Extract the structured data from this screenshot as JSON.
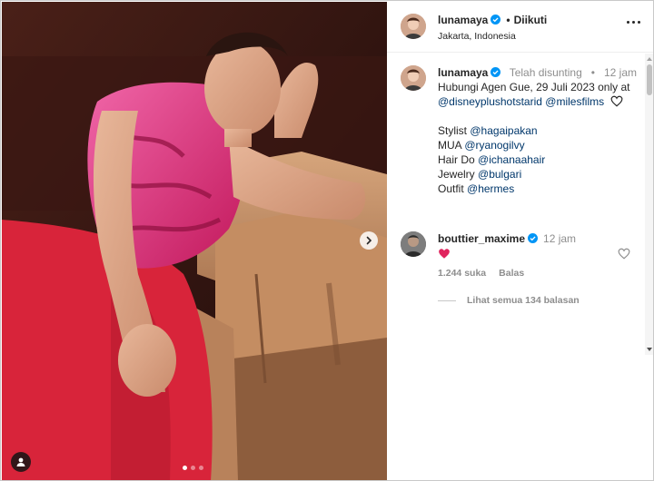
{
  "header": {
    "username": "lunamaya",
    "separator": "•",
    "follow_label": "Diikuti",
    "location": "Jakarta, Indonesia"
  },
  "caption": {
    "username": "lunamaya",
    "edited": "Telah disunting",
    "bullet": "•",
    "time": "12 jam",
    "line1": "Hubungi Agen Gue, 29 Juli 2023 only at",
    "mention_disney": "@disneyplushotstarid",
    "mention_miles": "@milesfilms",
    "stylist_label": "Stylist",
    "stylist_mention": "@hagaipakan",
    "mua_label": "MUA",
    "mua_mention": "@ryanogilvy",
    "hair_label": "Hair Do",
    "hair_mention": "@ichanaahair",
    "jewelry_label": "Jewelry",
    "jewelry_mention": "@bulgari",
    "outfit_label": "Outfit",
    "outfit_mention": "@hermes"
  },
  "comment": {
    "username": "bouttier_maxime",
    "time": "12 jam",
    "emoji": "red-heart-emoji",
    "likes": "1.244 suka",
    "reply_label": "Balas",
    "view_replies": "Lihat semua 134 balasan"
  },
  "carousel": {
    "slide_count": 3,
    "active_index": 0
  },
  "icons": {
    "verified": "verified-badge-icon",
    "more": "more-options-icon",
    "next": "chevron-right-icon",
    "tag": "user-tag-icon",
    "heart": "heart-outline-icon"
  },
  "colors": {
    "verified_blue": "#0095f6",
    "mention_blue": "#00376b",
    "muted_text": "#8e8e8e",
    "heart_red": "#ed4956"
  }
}
